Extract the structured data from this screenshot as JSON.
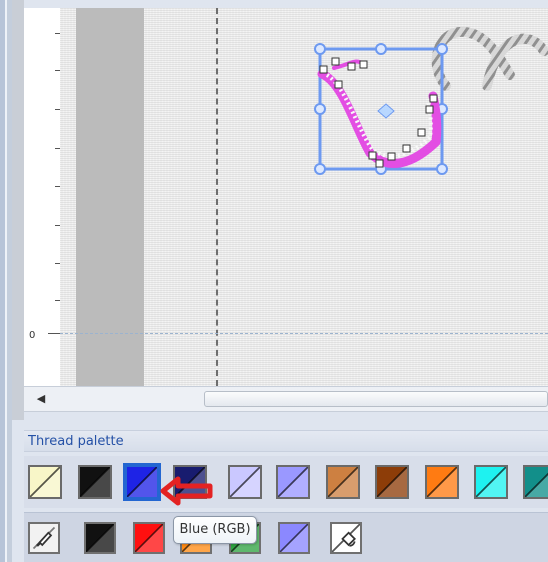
{
  "ruler": {
    "zero_label": "0"
  },
  "scrollbar": {
    "left_arrow": "◀"
  },
  "palette": {
    "title": "Thread palette",
    "tooltip": "Blue (RGB)",
    "swatches": [
      {
        "name": "pale-yellow-thread",
        "color": "#f8f6c8",
        "selected": false
      },
      {
        "name": "black-thread",
        "color": "#111111",
        "selected": false
      },
      {
        "name": "blue-thread",
        "color": "#1e23e6",
        "selected": true
      },
      {
        "name": "navy-thread",
        "color": "#181c6f",
        "selected": false
      },
      {
        "name": "lavender-thread",
        "color": "#cac8ff",
        "selected": false
      },
      {
        "name": "periwinkle-thread",
        "color": "#9a98ff",
        "selected": false
      },
      {
        "name": "tan-thread",
        "color": "#cd8041",
        "selected": false
      },
      {
        "name": "brown-thread",
        "color": "#8d3d08",
        "selected": false
      },
      {
        "name": "orange-thread",
        "color": "#ff7b12",
        "selected": false
      },
      {
        "name": "cyan-thread",
        "color": "#1ef2f0",
        "selected": false
      },
      {
        "name": "teal-thread",
        "color": "#128f8a",
        "selected": false
      }
    ]
  },
  "toolbar": {
    "items": [
      {
        "name": "pick-color-icon",
        "kind": "tool"
      },
      {
        "name": "black-thread-button",
        "color": "#111111"
      },
      {
        "name": "red-thread-button",
        "color": "#ff1010"
      },
      {
        "name": "orange-thread-button",
        "color": "#ff8a12"
      },
      {
        "name": "green-thread-button",
        "color": "#2ea341"
      },
      {
        "name": "periwinkle-thread-button",
        "color": "#8b88ff"
      },
      {
        "name": "fill-bucket-icon",
        "kind": "tool"
      }
    ]
  },
  "colors": {
    "selection_box": "#6d99f0",
    "stitch_magenta": "#e34ee3",
    "arrow_red": "#e32222"
  }
}
